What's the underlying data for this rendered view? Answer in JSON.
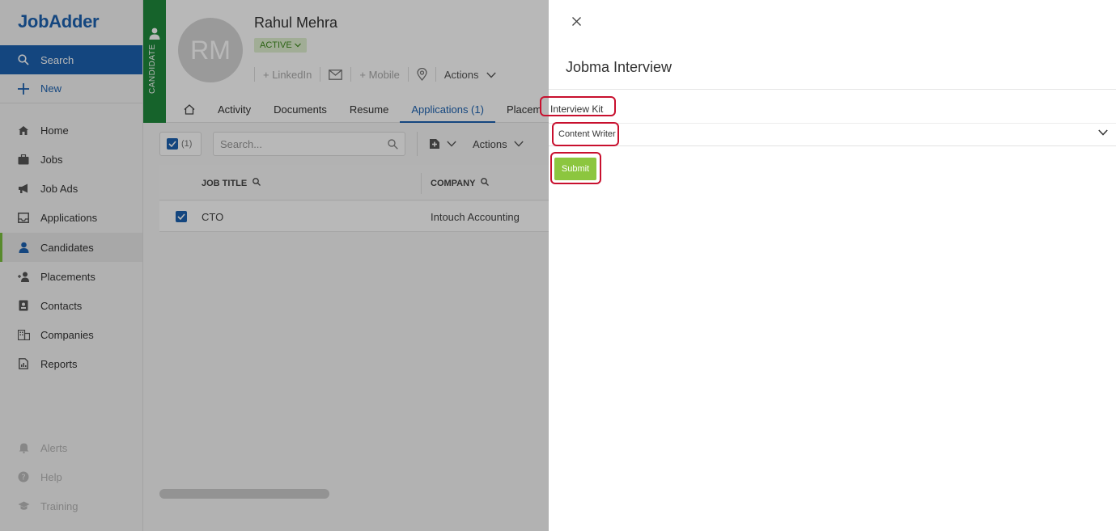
{
  "app": {
    "logo": "JobAdder"
  },
  "sidebar": {
    "search": "Search",
    "new": "New",
    "items": [
      {
        "label": "Home",
        "icon": "home-icon"
      },
      {
        "label": "Jobs",
        "icon": "briefcase-icon"
      },
      {
        "label": "Job Ads",
        "icon": "megaphone-icon"
      },
      {
        "label": "Applications",
        "icon": "inbox-icon"
      },
      {
        "label": "Candidates",
        "icon": "person-icon"
      },
      {
        "label": "Placements",
        "icon": "person-add-icon"
      },
      {
        "label": "Contacts",
        "icon": "contact-card-icon"
      },
      {
        "label": "Companies",
        "icon": "building-icon"
      },
      {
        "label": "Reports",
        "icon": "report-icon"
      }
    ],
    "bottom": [
      {
        "label": "Alerts",
        "icon": "bell-icon"
      },
      {
        "label": "Help",
        "icon": "help-icon"
      },
      {
        "label": "Training",
        "icon": "graduation-cap-icon"
      }
    ]
  },
  "candidate": {
    "strip_label": "CANDIDATE",
    "initials": "RM",
    "name": "Rahul Mehra",
    "status": "ACTIVE",
    "linkedin": "+ LinkedIn",
    "mobile": "+ Mobile",
    "actions": "Actions"
  },
  "tabs": [
    "Activity",
    "Documents",
    "Resume",
    "Applications (1)",
    "Placem"
  ],
  "toolbar": {
    "selected_count": "(1)",
    "search_placeholder": "Search...",
    "actions": "Actions"
  },
  "table": {
    "columns": [
      "JOB TITLE",
      "COMPANY"
    ],
    "rows": [
      {
        "job_title": "CTO",
        "company": "Intouch Accounting"
      }
    ]
  },
  "panel": {
    "title": "Jobma Interview",
    "kit_label": "Interview Kit",
    "kit_value": "Content Writer",
    "submit": "Submit"
  },
  "colors": {
    "brand_blue": "#1c62b0",
    "candidate_green": "#1f8a3c",
    "submit_green": "#8cc63f",
    "highlight_red": "#c8102e"
  }
}
